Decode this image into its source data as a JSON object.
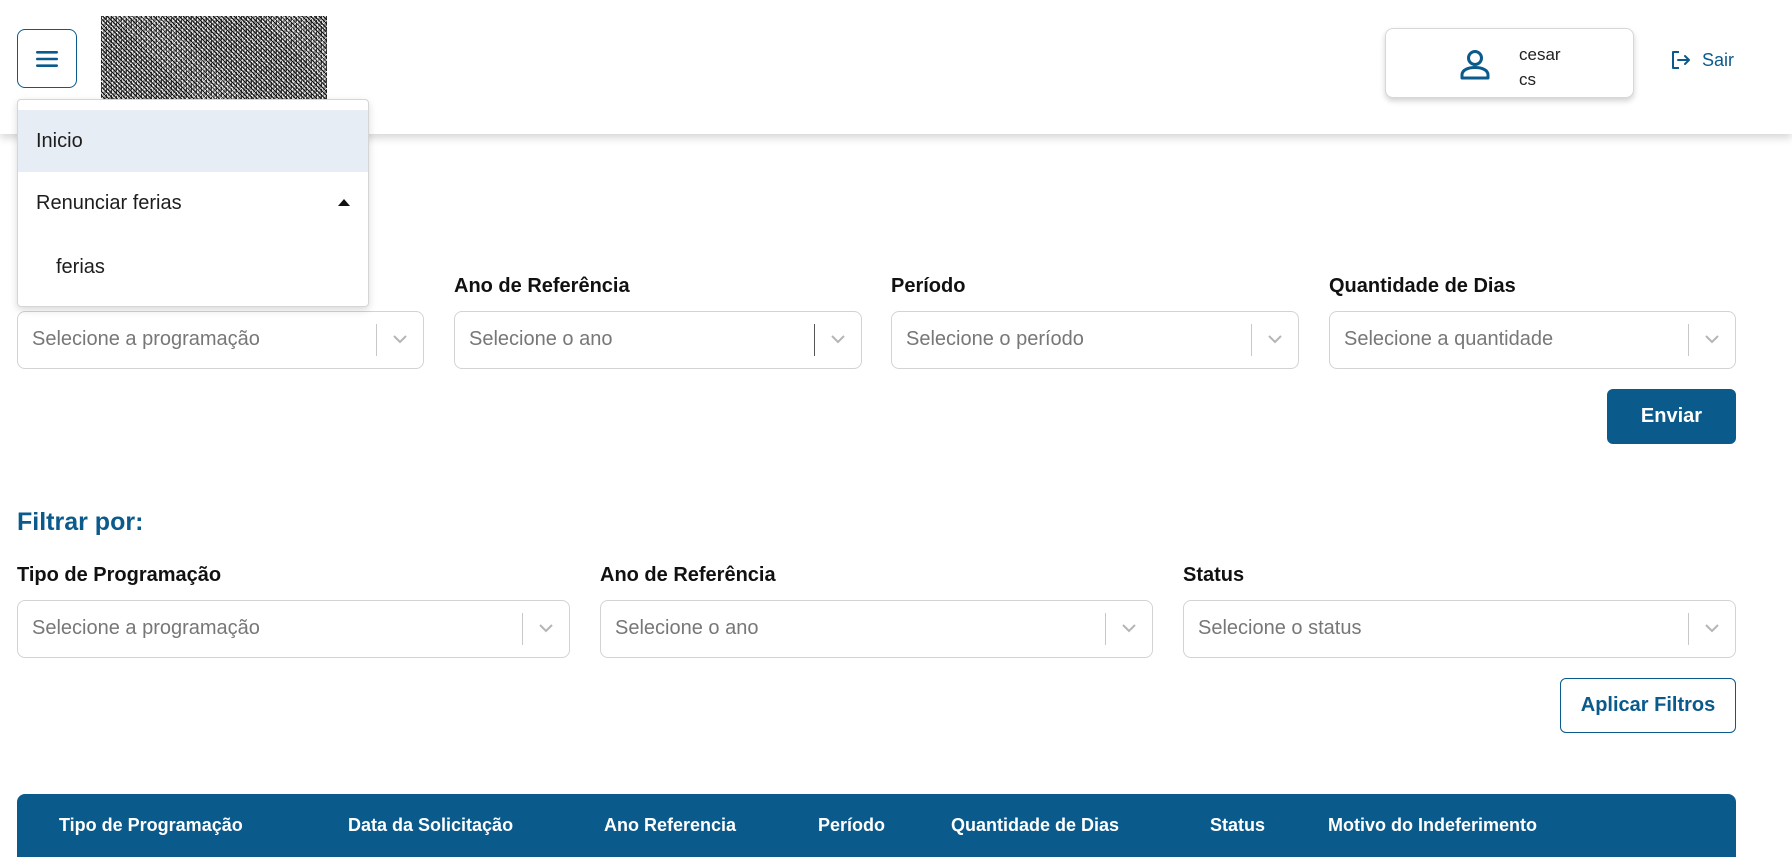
{
  "header": {
    "menu_icon": "hamburger-menu-icon",
    "user": {
      "name": "cesar",
      "login": "cs",
      "icon": "user-icon"
    },
    "logout_label": "Sair",
    "logout_icon": "logout-icon"
  },
  "menu": {
    "items": [
      {
        "label": "Inicio",
        "active": true
      },
      {
        "label": "Renunciar ferias",
        "expanded": true,
        "children": [
          {
            "label": "ferias"
          }
        ]
      }
    ]
  },
  "form": {
    "fields": [
      {
        "label": "",
        "placeholder": "Selecione a programação"
      },
      {
        "label": "Ano de Referência",
        "placeholder": "Selecione o ano"
      },
      {
        "label": "Período",
        "placeholder": "Selecione o período"
      },
      {
        "label": "Quantidade de Dias",
        "placeholder": "Selecione a quantidade"
      }
    ],
    "submit_label": "Enviar"
  },
  "filters": {
    "title": "Filtrar por:",
    "fields": [
      {
        "label": "Tipo de Programação",
        "placeholder": "Selecione a programação"
      },
      {
        "label": "Ano de Referência",
        "placeholder": "Selecione o ano"
      },
      {
        "label": "Status",
        "placeholder": "Selecione o status"
      }
    ],
    "apply_label": "Aplicar Filtros"
  },
  "table": {
    "columns": [
      "Tipo de Programação",
      "Data da Solicitação",
      "Ano Referencia",
      "Período",
      "Quantidade de Dias",
      "Status",
      "Motivo do Indeferimento"
    ]
  },
  "colors": {
    "primary": "#0b5a8c",
    "menu_active_bg": "#e6edf4",
    "border": "#d3d3d3"
  }
}
